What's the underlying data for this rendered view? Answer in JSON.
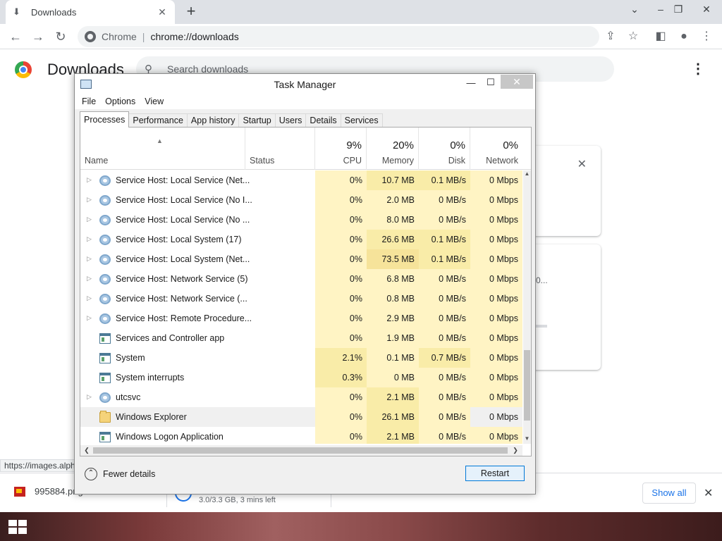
{
  "browser": {
    "tab_title": "Downloads",
    "tab_icon": "download-icon",
    "address_site": "Chrome",
    "address_url": "chrome://downloads"
  },
  "downloads_page": {
    "title": "Downloads",
    "search_placeholder": "Search downloads",
    "card_fragment": "0..."
  },
  "status_tooltip": "https://images.alph",
  "shelf": {
    "item1_name": "995884.png",
    "item2_sub": "3.0/3.3 GB, 3 mins left",
    "show_all": "Show all"
  },
  "task_manager": {
    "title": "Task Manager",
    "menu": [
      "File",
      "Options",
      "View"
    ],
    "tabs": [
      "Processes",
      "Performance",
      "App history",
      "Startup",
      "Users",
      "Details",
      "Services"
    ],
    "active_tab": "Processes",
    "header": {
      "name": "Name",
      "status": "Status",
      "cpu_pct": "9%",
      "cpu": "CPU",
      "mem_pct": "20%",
      "mem": "Memory",
      "disk_pct": "0%",
      "disk": "Disk",
      "net_pct": "0%",
      "net": "Network"
    },
    "rows": [
      {
        "name": "Service Host: Local Service (Net...",
        "icon": "gear-icon",
        "expandable": true,
        "cpu": "0%",
        "mem": "10.7 MB",
        "disk": "0.1 MB/s",
        "net": "0 Mbps",
        "heat": {
          "cpu": 0,
          "mem": 1,
          "disk": 1
        }
      },
      {
        "name": "Service Host: Local Service (No I...",
        "icon": "gear-icon",
        "expandable": true,
        "cpu": "0%",
        "mem": "2.0 MB",
        "disk": "0 MB/s",
        "net": "0 Mbps",
        "heat": {
          "cpu": 0,
          "mem": 0,
          "disk": 0
        }
      },
      {
        "name": "Service Host: Local Service (No ...",
        "icon": "gear-icon",
        "expandable": true,
        "cpu": "0%",
        "mem": "8.0 MB",
        "disk": "0 MB/s",
        "net": "0 Mbps",
        "heat": {
          "cpu": 0,
          "mem": 0,
          "disk": 0
        }
      },
      {
        "name": "Service Host: Local System (17)",
        "icon": "gear-icon",
        "expandable": true,
        "cpu": "0%",
        "mem": "26.6 MB",
        "disk": "0.1 MB/s",
        "net": "0 Mbps",
        "heat": {
          "cpu": 0,
          "mem": 1,
          "disk": 1
        }
      },
      {
        "name": "Service Host: Local System (Net...",
        "icon": "gear-icon",
        "expandable": true,
        "cpu": "0%",
        "mem": "73.5 MB",
        "disk": "0.1 MB/s",
        "net": "0 Mbps",
        "heat": {
          "cpu": 0,
          "mem": 2,
          "disk": 1
        }
      },
      {
        "name": "Service Host: Network Service (5)",
        "icon": "gear-icon",
        "expandable": true,
        "cpu": "0%",
        "mem": "6.8 MB",
        "disk": "0 MB/s",
        "net": "0 Mbps",
        "heat": {
          "cpu": 0,
          "mem": 0,
          "disk": 0
        }
      },
      {
        "name": "Service Host: Network Service (...",
        "icon": "gear-icon",
        "expandable": true,
        "cpu": "0%",
        "mem": "0.8 MB",
        "disk": "0 MB/s",
        "net": "0 Mbps",
        "heat": {
          "cpu": 0,
          "mem": 0,
          "disk": 0
        }
      },
      {
        "name": "Service Host: Remote Procedure...",
        "icon": "gear-icon",
        "expandable": true,
        "cpu": "0%",
        "mem": "2.9 MB",
        "disk": "0 MB/s",
        "net": "0 Mbps",
        "heat": {
          "cpu": 0,
          "mem": 0,
          "disk": 0
        }
      },
      {
        "name": "Services and Controller app",
        "icon": "app-window-icon",
        "expandable": false,
        "cpu": "0%",
        "mem": "1.9 MB",
        "disk": "0 MB/s",
        "net": "0 Mbps",
        "heat": {
          "cpu": 0,
          "mem": 0,
          "disk": 0
        }
      },
      {
        "name": "System",
        "icon": "app-window-icon",
        "expandable": false,
        "cpu": "2.1%",
        "mem": "0.1 MB",
        "disk": "0.7 MB/s",
        "net": "0 Mbps",
        "heat": {
          "cpu": 1,
          "mem": 0,
          "disk": 1
        }
      },
      {
        "name": "System interrupts",
        "icon": "app-window-icon",
        "expandable": false,
        "cpu": "0.3%",
        "mem": "0 MB",
        "disk": "0 MB/s",
        "net": "0 Mbps",
        "heat": {
          "cpu": 1,
          "mem": 0,
          "disk": 0
        }
      },
      {
        "name": "utcsvc",
        "icon": "gear-icon",
        "expandable": true,
        "cpu": "0%",
        "mem": "2.1 MB",
        "disk": "0 MB/s",
        "net": "0 Mbps",
        "heat": {
          "cpu": 0,
          "mem": 1,
          "disk": 0
        }
      },
      {
        "name": "Windows Explorer",
        "icon": "folder-icon",
        "expandable": false,
        "selected": true,
        "cpu": "0%",
        "mem": "26.1 MB",
        "disk": "0 MB/s",
        "net": "0 Mbps",
        "heat": {
          "cpu": 0,
          "mem": 1,
          "disk": 0
        }
      },
      {
        "name": "Windows Logon Application",
        "icon": "app-window-icon",
        "expandable": false,
        "cpu": "0%",
        "mem": "2.1 MB",
        "disk": "0 MB/s",
        "net": "0 Mbps",
        "heat": {
          "cpu": 0,
          "mem": 1,
          "disk": 0
        }
      }
    ],
    "fewer_details": "Fewer details",
    "restart": "Restart"
  },
  "colors": {
    "heat_0": "#fff4c4",
    "heat_1": "#f9eca8",
    "heat_2": "#f6e39a",
    "selected_row": "#f0f0f0",
    "accent": "#1a73e8"
  }
}
